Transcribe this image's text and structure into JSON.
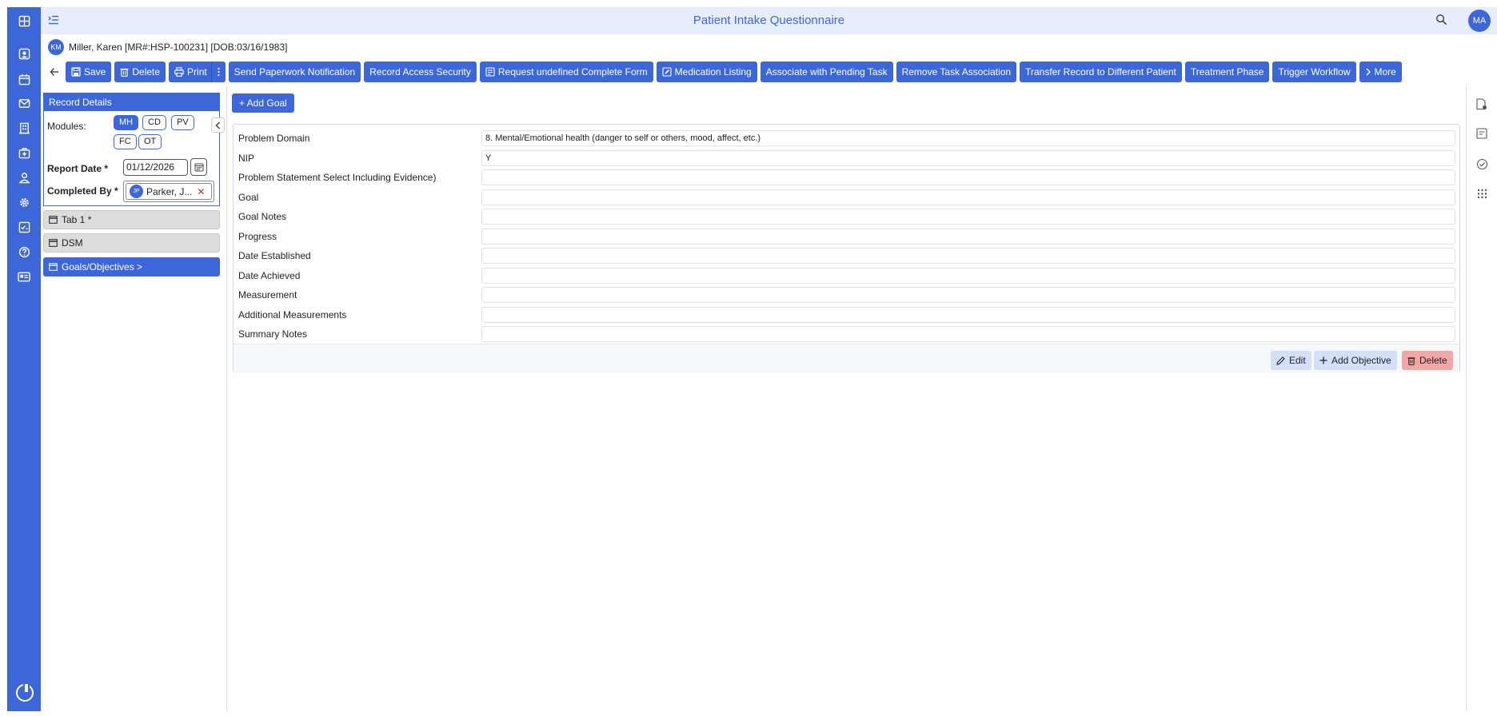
{
  "app": {
    "title": "Patient Intake Questionnaire",
    "user_initials": "MA"
  },
  "patient": {
    "initials": "KM",
    "text": "Miller, Karen [MR#:HSP-100231] [DOB:03/16/1983]"
  },
  "toolbar": {
    "save": "Save",
    "delete": "Delete",
    "print": "Print",
    "send_paperwork": "Send Paperwork Notification",
    "record_access": "Record Access Security",
    "request_complete": "Request undefined Complete Form",
    "medication_listing": "Medication Listing",
    "associate_task": "Associate with Pending Task",
    "remove_task": "Remove Task Association",
    "transfer_record": "Transfer Record to Different Patient",
    "treatment_phase": "Treatment Phase",
    "trigger_workflow": "Trigger Workflow",
    "more": "More"
  },
  "record_details": {
    "header": "Record Details",
    "modules_label": "Modules:",
    "modules": [
      {
        "label": "MH",
        "active": true
      },
      {
        "label": "CD",
        "active": false
      },
      {
        "label": "PV",
        "active": false
      },
      {
        "label": "FC",
        "active": false
      },
      {
        "label": "OT",
        "active": false
      }
    ],
    "report_date_label": "Report Date *",
    "report_date": "01/12/2026",
    "completed_by_label": "Completed By *",
    "completed_by_initials": "JP",
    "completed_by": "Parker, J..."
  },
  "nav_tabs": [
    {
      "label": "Tab 1 *",
      "active": false
    },
    {
      "label": "DSM",
      "active": false
    },
    {
      "label": "Goals/Objectives >",
      "active": true
    }
  ],
  "main": {
    "add_goal": "+ Add Goal",
    "fields": [
      {
        "label": "Problem Domain",
        "value": "8. Mental/Emotional health (danger to self or others, mood, affect, etc.)"
      },
      {
        "label": "NIP",
        "value": "Y"
      },
      {
        "label": "Problem Statement Select Including Evidence)",
        "value": ""
      },
      {
        "label": "Goal",
        "value": ""
      },
      {
        "label": "Goal Notes",
        "value": ""
      },
      {
        "label": "Progress",
        "value": ""
      },
      {
        "label": "Date Established",
        "value": ""
      },
      {
        "label": "Date Achieved",
        "value": ""
      },
      {
        "label": "Measurement",
        "value": ""
      },
      {
        "label": "Additional Measurements",
        "value": ""
      },
      {
        "label": "Summary Notes",
        "value": ""
      }
    ],
    "edit": "Edit",
    "add_objective": "Add Objective",
    "delete": "Delete"
  },
  "colors": {
    "brand": "#3d67d8",
    "title_bar": "#e7edfb",
    "delete_bg": "#f2a6a6",
    "light_button": "#d3e0f7"
  },
  "icons": {
    "left_rail": [
      "dashboard-icon",
      "patient-card-icon",
      "calendar-icon",
      "mail-icon",
      "building-icon",
      "medical-bag-icon",
      "person-icon",
      "gear-icon",
      "checklist-icon",
      "help-icon",
      "id-card-icon",
      "power-icon"
    ],
    "right_rail": [
      "document-settings-icon",
      "notes-icon",
      "check-circle-icon",
      "apps-grid-icon"
    ]
  }
}
